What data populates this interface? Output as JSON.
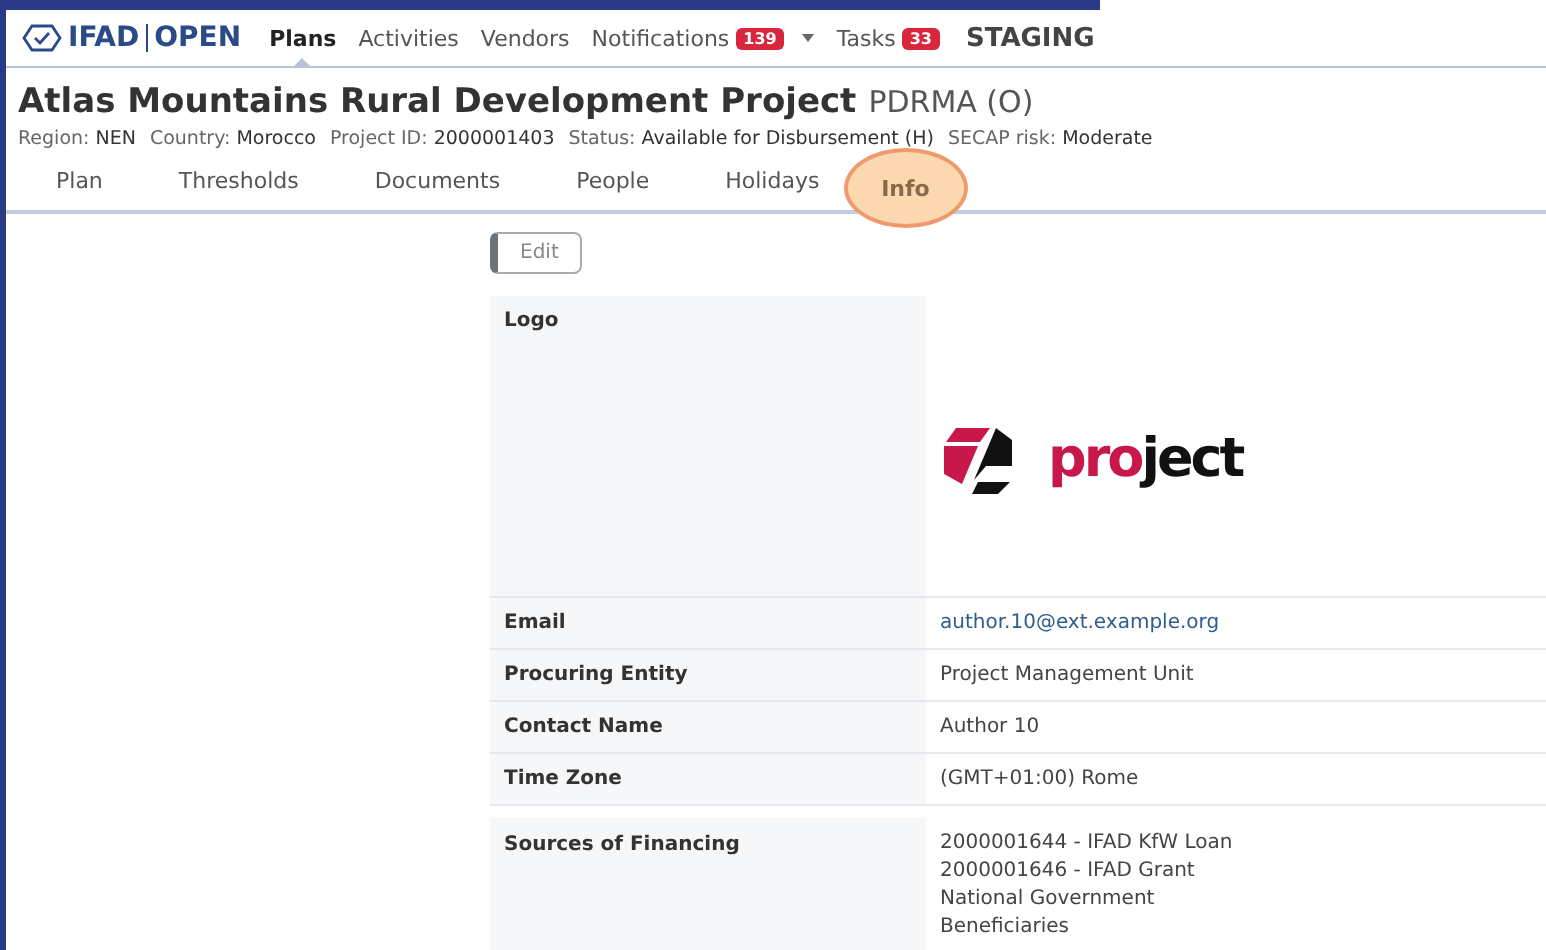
{
  "nav": {
    "brand_left": "IFAD",
    "brand_right": "OPEN",
    "items": [
      {
        "label": "Plans",
        "selected": true
      },
      {
        "label": "Activities",
        "selected": false
      },
      {
        "label": "Vendors",
        "selected": false
      },
      {
        "label": "Notifications",
        "selected": false,
        "badge": "139",
        "has_menu": true
      },
      {
        "label": "Tasks",
        "selected": false,
        "badge": "33"
      }
    ],
    "environment": "STAGING"
  },
  "header": {
    "title": "Atlas Mountains Rural Development Project",
    "code": "PDRMA (O)",
    "fields": [
      {
        "label": "Region:",
        "value": "NEN"
      },
      {
        "label": "Country:",
        "value": "Morocco"
      },
      {
        "label": "Project ID:",
        "value": "2000001403"
      },
      {
        "label": "Status:",
        "value": "Available for Disbursement (H)"
      },
      {
        "label": "SECAP risk:",
        "value": "Moderate"
      }
    ]
  },
  "tabs": [
    {
      "label": "Plan",
      "selected": false
    },
    {
      "label": "Thresholds",
      "selected": false
    },
    {
      "label": "Documents",
      "selected": false
    },
    {
      "label": "People",
      "selected": false
    },
    {
      "label": "Holidays",
      "selected": false
    },
    {
      "label": "Info",
      "selected": true
    }
  ],
  "edit_button": "Edit",
  "rows": [
    {
      "label": "Logo",
      "kind": "logo",
      "logo_parts": [
        {
          "text": "pro",
          "color": "#c8174a"
        },
        {
          "text": "ject",
          "color": "#111111"
        }
      ]
    },
    {
      "label": "Email",
      "kind": "link",
      "value": "author.10@ext.example.org"
    },
    {
      "label": "Procuring Entity",
      "kind": "text",
      "value": "Project Management Unit"
    },
    {
      "label": "Contact Name",
      "kind": "text",
      "value": "Author 10"
    },
    {
      "label": "Time Zone",
      "kind": "text",
      "value": "(GMT+01:00) Rome"
    },
    {
      "label": "Sources of Financing",
      "kind": "lines",
      "lines": [
        "2000001644 - IFAD KfW Loan",
        "2000001646 - IFAD Grant",
        "National Government",
        "Beneficiaries"
      ]
    }
  ]
}
